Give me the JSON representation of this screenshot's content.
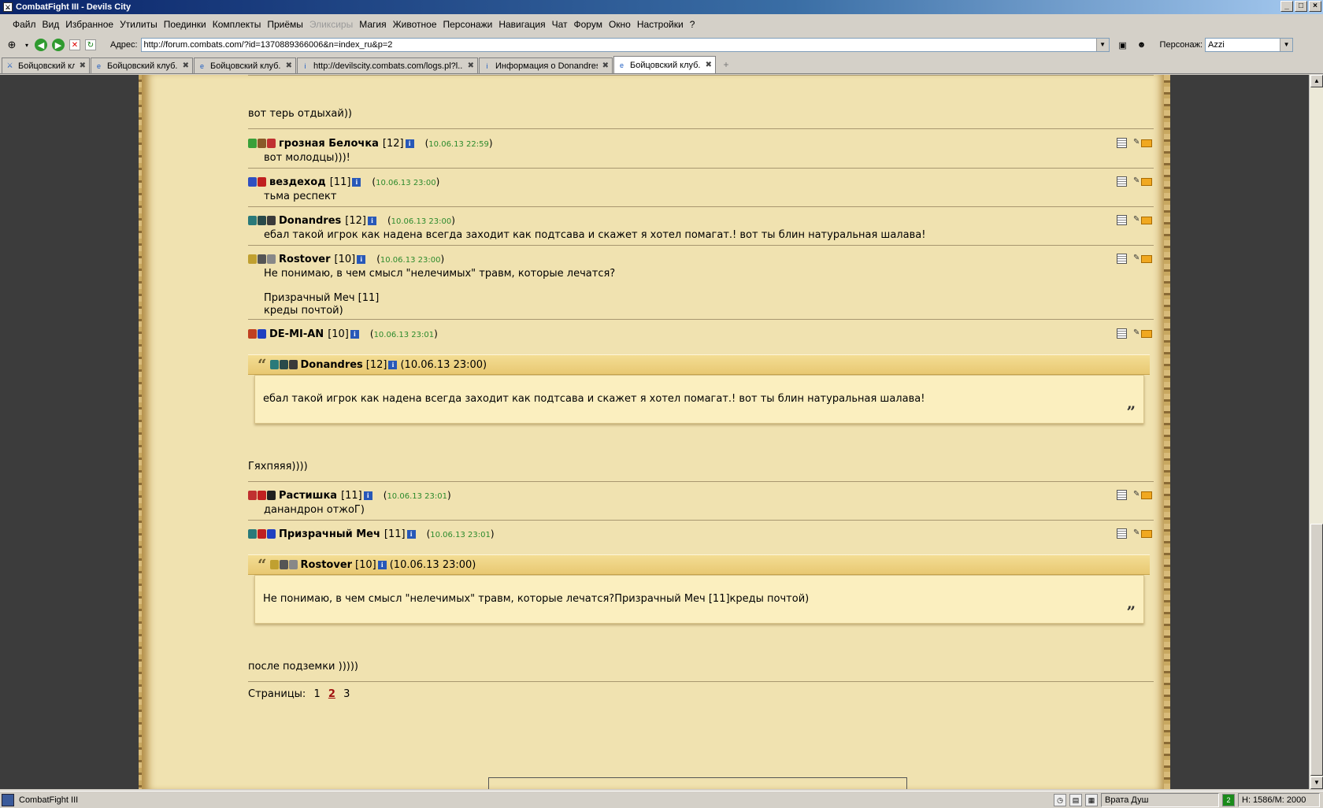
{
  "window": {
    "title": "CombatFight III - Devils City"
  },
  "menu": [
    "Файл",
    "Вид",
    "Избранное",
    "Утилиты",
    "Поединки",
    "Комплекты",
    "Приёмы",
    "Эликсиры",
    "Магия",
    "Животное",
    "Персонажи",
    "Навигация",
    "Чат",
    "Форум",
    "Окно",
    "Настройки",
    "?"
  ],
  "menu_disabled": [
    "Эликсиры"
  ],
  "address": {
    "label": "Адрес:",
    "url": "http://forum.combats.com/?id=1370889366006&n=index_ru&p=2"
  },
  "persona": {
    "label": "Персонаж:",
    "value": "Azzi"
  },
  "tabs": [
    {
      "label": "Бойцовский клуб",
      "active": false
    },
    {
      "label": "Бойцовский клуб.",
      "active": false
    },
    {
      "label": "Бойцовский клуб.",
      "active": false
    },
    {
      "label": "http://devilscity.combats.com/logs.pl?l...",
      "active": false
    },
    {
      "label": "Информация о Donandres",
      "active": false
    },
    {
      "label": "Бойцовский клуб.",
      "active": true
    }
  ],
  "forum": {
    "intro_text": "вот терь отдыхай))",
    "posts": [
      {
        "author": "грозная Белочка",
        "level": "[12]",
        "date": "10.06.13 22:59",
        "body": [
          "вот молодцы)))!"
        ],
        "badge_colors": [
          "#3aa03a",
          "#8a5a2a",
          "#c03030"
        ]
      },
      {
        "author": "вездеход",
        "level": "[11]",
        "date": "10.06.13 23:00",
        "body": [
          "тьма респект"
        ],
        "badge_colors": [
          "#3050c0",
          "#c02020"
        ]
      },
      {
        "author": "Donandres",
        "level": "[12]",
        "date": "10.06.13 23:00",
        "body": [
          "ебал такой игрок как надена всегда заходит как подтсава и скажет я хотел помагат.! вот ты блин натуральная шалава!"
        ],
        "badge_colors": [
          "#2a7a7a",
          "#2a4a4a",
          "#3a3a3a"
        ]
      },
      {
        "author": "Rostover",
        "level": "[10]",
        "date": "10.06.13 23:00",
        "body": [
          "Не понимаю, в чем смысл \"нелечимых\" травм, которые лечатся?",
          "",
          "Призрачный Меч [11]",
          "креды почтой)"
        ],
        "badge_colors": [
          "#c0a030",
          "#555555",
          "#888888"
        ]
      },
      {
        "author": "DE-MI-AN",
        "level": "[10]",
        "date": "10.06.13 23:01",
        "body": [],
        "badge_colors": [
          "#c04020",
          "#2040c0"
        ]
      },
      {
        "author": "Растишка",
        "level": "[11]",
        "date": "10.06.13 23:01",
        "body": [
          "данандрон отжоГ)"
        ],
        "badge_colors": [
          "#c03030",
          "#c02020",
          "#202020"
        ]
      },
      {
        "author": "Призрачный Меч",
        "level": "[11]",
        "date": "10.06.13 23:01",
        "body": [],
        "badge_colors": [
          "#2a7a7a",
          "#c02020",
          "#2040c0"
        ]
      }
    ],
    "quote1": {
      "author": "Donandres",
      "level": "[12]",
      "date": "(10.06.13 23:00)",
      "text": "ебал такой игрок как надена всегда заходит как подтсава и скажет я хотел помагат.! вот ты блин натуральная шалава!"
    },
    "reply1": "Гяхпяяя))))",
    "quote2": {
      "author": "Rostover",
      "level": "[10]",
      "date": "(10.06.13 23:00)",
      "text": "Не понимаю, в чем смысл \"нелечимых\" травм, которые лечатся?Призрачный Меч [11]креды почтой)"
    },
    "reply2": "после подземки )))))",
    "pager": {
      "label": "Страницы:",
      "pages": [
        "1",
        "2",
        "3"
      ],
      "current": "2"
    }
  },
  "status": {
    "app": "CombatFight III",
    "location": "Врата Душ",
    "hp": "Н: 1586/М: 2000"
  }
}
